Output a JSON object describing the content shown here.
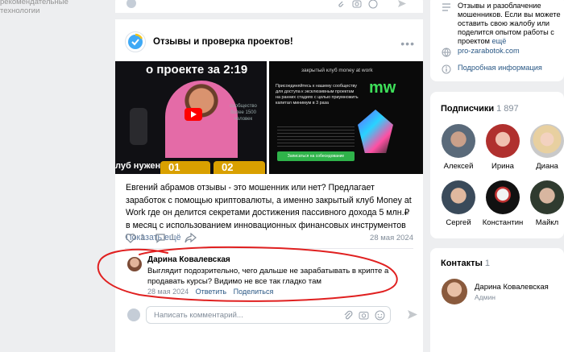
{
  "left_nav": {
    "partial_text": "рекомендательные технологии"
  },
  "post": {
    "group_title": "Отзывы и проверка проектов!",
    "image1": {
      "top_text": "о проекте за 2:19",
      "side_text": "сообщество более 1500 человек",
      "bottom_text": "луб нужен",
      "digits": [
        "01",
        "02"
      ]
    },
    "image2": {
      "header": "закрытый клуб money at work",
      "logo": "mw",
      "headline": "Присоединяйтесь к нашему сообществу для доступа к эксклюзивным проектам на ранних стадиях с целью приумножить капитал минимум в 3 раза",
      "button": "Записаться на собеседование"
    },
    "text": "Евгений абрамов отзывы - это мошенник или нет? Предлагает заработок с помощью криптовалюты, а именно закрытый клуб Money at Work где он делится секретами достижения пассивного дохода 5 млн.₽ в месяц с использованием инновационных финансовых инструментов",
    "show_more": "Показать ещё",
    "likes": "1",
    "comments": "1",
    "date": "28 мая 2024"
  },
  "comment": {
    "author": "Дарина Ковалевская",
    "text": "Выглядит подозрительно, чего дальше не зарабатывать в крипте а продавать курсы? Видимо не все так гладко там",
    "date": "28 мая 2024",
    "reply": "Ответить",
    "share": "Поделиться"
  },
  "new_comment": {
    "placeholder": "Написать комментарий..."
  },
  "info": {
    "description": "Отзывы и разоблачение мошенников. Если вы можете оставить свою жалобу или поделится опытом работы с проектом",
    "show_more": "ещё",
    "website": "pro-zarabotok.com",
    "details": "Подробная информация"
  },
  "subscribers": {
    "title": "Подписчики",
    "count": "1 897",
    "items": [
      {
        "name": "Алексей"
      },
      {
        "name": "Ирина"
      },
      {
        "name": "Диана"
      },
      {
        "name": "Сергей"
      },
      {
        "name": "Константин"
      },
      {
        "name": "Майкл"
      }
    ]
  },
  "contacts": {
    "title": "Контакты",
    "count": "1",
    "name": "Дарина Ковалевская",
    "role": "Админ"
  },
  "colors": {
    "accent_link": "#2a5885",
    "annotation": "#e02020",
    "green_accent": "#3ee05a"
  }
}
